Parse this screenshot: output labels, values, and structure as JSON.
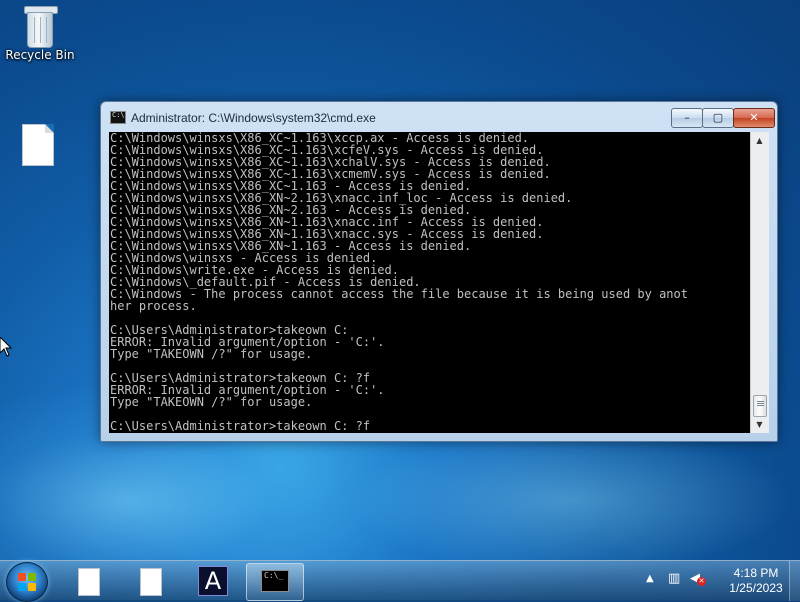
{
  "desktop": {
    "icons": [
      {
        "label": "Recycle Bin",
        "icon": "recycle-bin-icon"
      },
      {
        "label": "",
        "icon": "file-icon"
      }
    ]
  },
  "window": {
    "title": "Administrator: C:\\Windows\\system32\\cmd.exe",
    "console_lines": [
      "C:\\Windows\\winsxs\\X86_XC~1.163\\xccp.ax - Access is denied.",
      "C:\\Windows\\winsxs\\X86_XC~1.163\\xcfeV.sys - Access is denied.",
      "C:\\Windows\\winsxs\\X86_XC~1.163\\xchalV.sys - Access is denied.",
      "C:\\Windows\\winsxs\\X86_XC~1.163\\xcmemV.sys - Access is denied.",
      "C:\\Windows\\winsxs\\X86_XC~1.163 - Access is denied.",
      "C:\\Windows\\winsxs\\X86_XN~2.163\\xnacc.inf_loc - Access is denied.",
      "C:\\Windows\\winsxs\\X86_XN~2.163 - Access is denied.",
      "C:\\Windows\\winsxs\\X86_XN~1.163\\xnacc.inf - Access is denied.",
      "C:\\Windows\\winsxs\\X86_XN~1.163\\xnacc.sys - Access is denied.",
      "C:\\Windows\\winsxs\\X86_XN~1.163 - Access is denied.",
      "C:\\Windows\\winsxs - Access is denied.",
      "C:\\Windows\\write.exe - Access is denied.",
      "C:\\Windows\\_default.pif - Access is denied.",
      "C:\\Windows - The process cannot access the file because it is being used by anot",
      "her process.",
      "",
      "C:\\Users\\Administrator>takeown C:",
      "ERROR: Invalid argument/option - 'C:'.",
      "Type \"TAKEOWN /?\" for usage.",
      "",
      "C:\\Users\\Administrator>takeown C: ?f",
      "ERROR: Invalid argument/option - 'C:'.",
      "Type \"TAKEOWN /?\" for usage.",
      "",
      "C:\\Users\\Administrator>takeown C: ?f"
    ],
    "buttons": {
      "minimize": "–",
      "maximize": "▢",
      "close": "✕"
    }
  },
  "taskbar": {
    "items": [
      {
        "icon": "document-icon",
        "active": false
      },
      {
        "icon": "document-icon",
        "active": false
      },
      {
        "icon": "app-a-icon",
        "active": false,
        "glyph": "A"
      },
      {
        "icon": "cmd-icon",
        "active": true,
        "glyph": "C:\\_"
      }
    ],
    "clock": {
      "time": "4:18 PM",
      "date": "1/25/2023"
    }
  }
}
